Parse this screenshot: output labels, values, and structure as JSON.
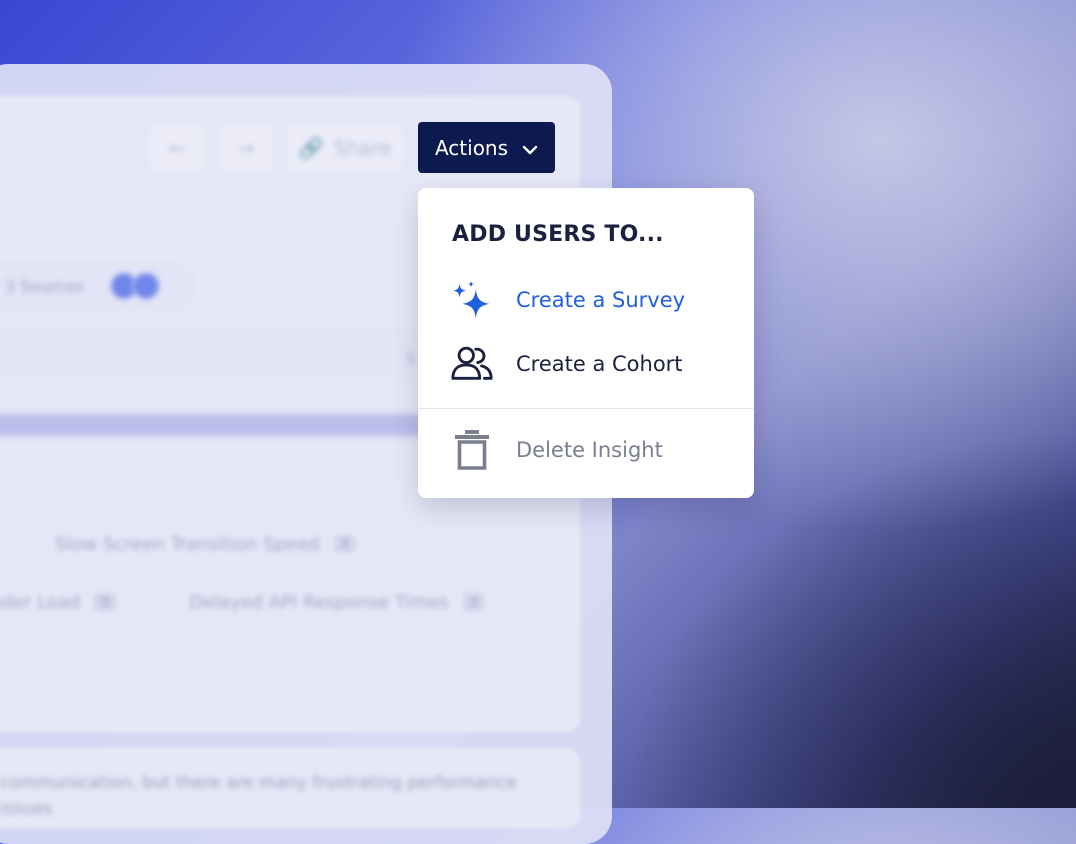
{
  "toolbar": {
    "share_label": "Share",
    "actions_label": "Actions"
  },
  "background": {
    "sources_label": "3 Sources",
    "chips": [
      {
        "label": "Slow Screen Transition Speed",
        "count": "3"
      },
      {
        "label": "Under Load",
        "count": "3"
      },
      {
        "label": "Delayed API Response Times",
        "count": "3"
      }
    ],
    "paragraph": "communication, but there are many frustrating performance issues"
  },
  "menu": {
    "heading": "ADD USERS TO...",
    "items": [
      {
        "label": "Create a Survey",
        "icon": "sparkles-icon",
        "color": "#1f5fe0"
      },
      {
        "label": "Create a Cohort",
        "icon": "users-icon",
        "color": "#1b2040"
      },
      {
        "label": "Delete Insight",
        "icon": "trash-icon",
        "color": "#7a7f8f"
      }
    ]
  },
  "colors": {
    "actions_bg": "#0d1a4f",
    "accent": "#1f5fe0"
  }
}
